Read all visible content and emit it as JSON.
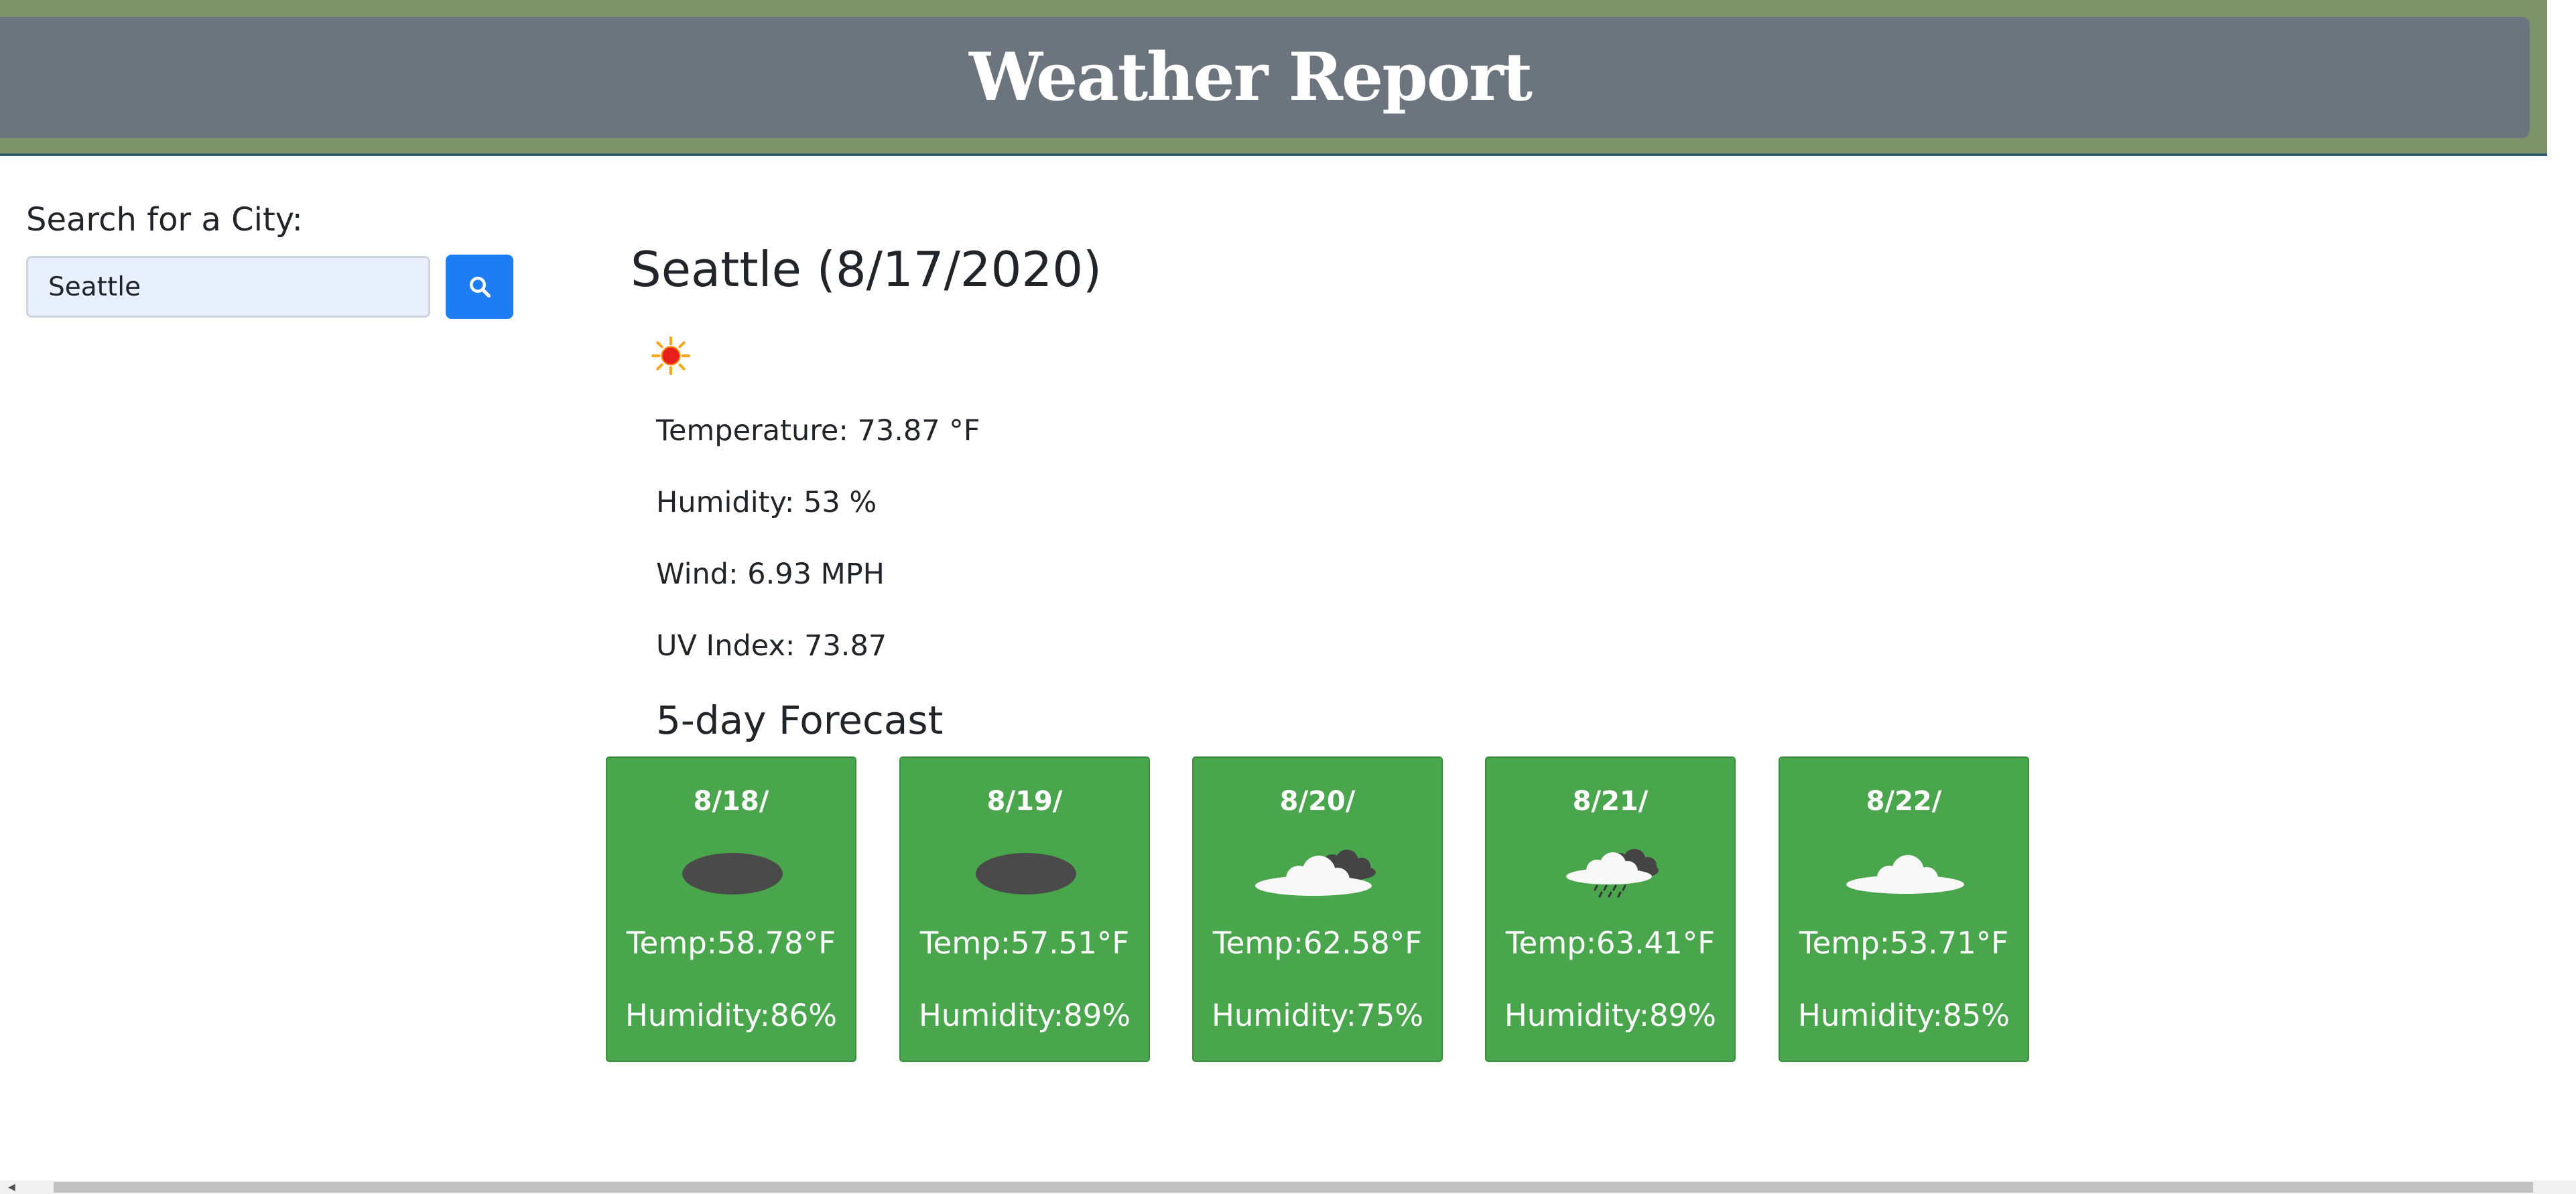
{
  "header": {
    "title": "Weather Report"
  },
  "search": {
    "label": "Search for a City:",
    "value": "Seattle",
    "button_icon": "search-icon"
  },
  "current": {
    "heading": "Seattle (8/17/2020)",
    "icon": "sun-icon",
    "temperature": "Temperature: 73.87 °F",
    "humidity": "Humidity: 53 %",
    "wind": "Wind: 6.93 MPH",
    "uv": "UV Index: 73.87"
  },
  "forecast": {
    "title": "5-day Forecast",
    "days": [
      {
        "date": "8/18/",
        "icon": "dark-cloud-icon",
        "temp": "Temp:58.78°F",
        "humidity": "Humidity:86%"
      },
      {
        "date": "8/19/",
        "icon": "dark-cloud-icon",
        "temp": "Temp:57.51°F",
        "humidity": "Humidity:89%"
      },
      {
        "date": "8/20/",
        "icon": "broken-clouds-icon",
        "temp": "Temp:62.58°F",
        "humidity": "Humidity:75%"
      },
      {
        "date": "8/21/",
        "icon": "rain-cloud-icon",
        "temp": "Temp:63.41°F",
        "humidity": "Humidity:89%"
      },
      {
        "date": "8/22/",
        "icon": "cloud-icon",
        "temp": "Temp:53.71°F",
        "humidity": "Humidity:85%"
      }
    ]
  },
  "colors": {
    "header_band": "#7d9269",
    "title_bar": "#6c757d",
    "search_button": "#1e7cf5",
    "forecast_card": "#4aa64c"
  }
}
